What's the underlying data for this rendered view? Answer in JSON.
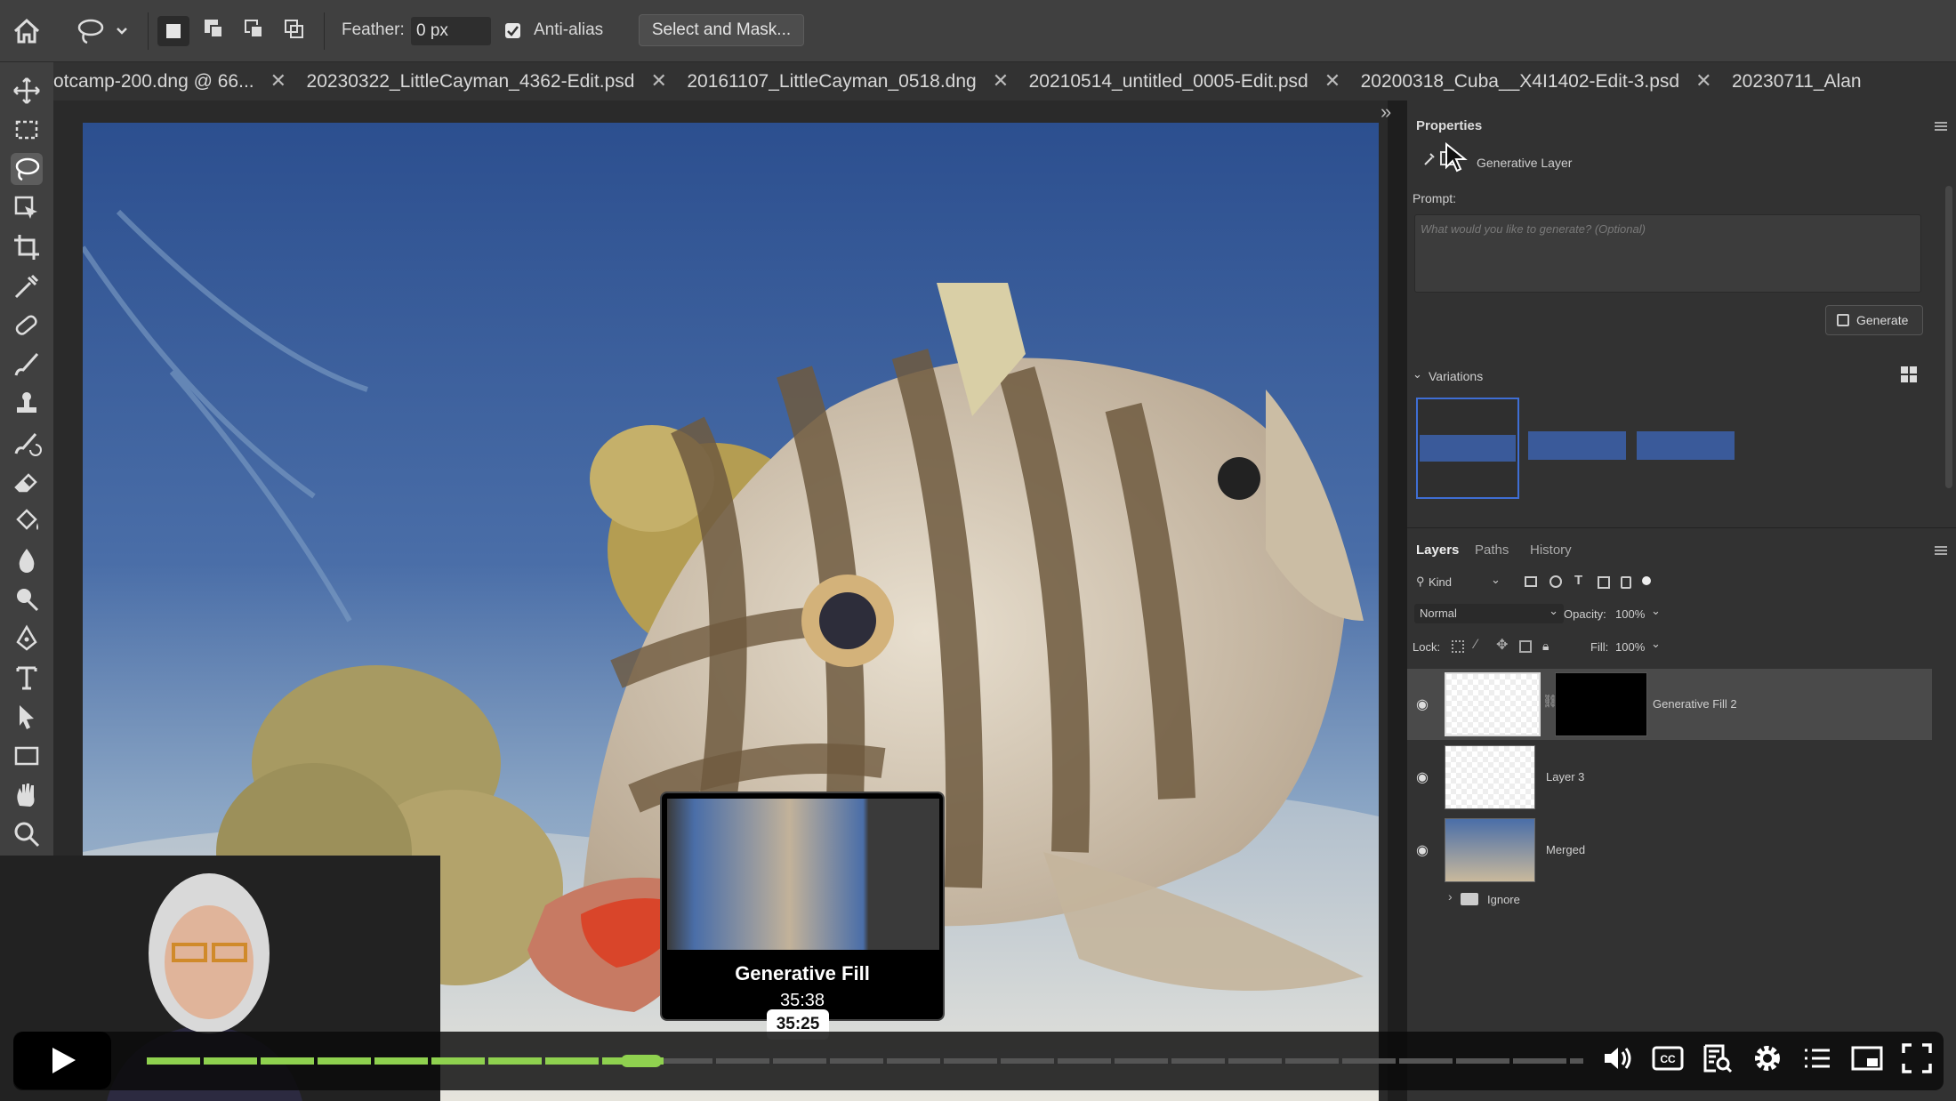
{
  "options_bar": {
    "feather_label": "Feather:",
    "feather_value": "0 px",
    "antialias_label": "Anti-alias",
    "select_mask_label": "Select and Mask..."
  },
  "tabs": [
    {
      "label": "otcamp-200.dng @ 66..."
    },
    {
      "label": "20230322_LittleCayman_4362-Edit.psd"
    },
    {
      "label": "20161107_LittleCayman_0518.dng"
    },
    {
      "label": "20210514_untitled_0005-Edit.psd"
    },
    {
      "label": "20200318_Cuba__X4I1402-Edit-3.psd"
    },
    {
      "label": "20230711_Alan"
    }
  ],
  "properties": {
    "title": "Properties",
    "layer_type": "Generative Layer",
    "prompt_label": "Prompt:",
    "prompt_placeholder": "What would you like to generate? (Optional)",
    "generate_label": "Generate",
    "variations_label": "Variations"
  },
  "layers_panel": {
    "tabs": [
      "Layers",
      "Paths",
      "History"
    ],
    "kind_label": "Kind",
    "blend_mode": "Normal",
    "opacity_label": "Opacity:",
    "opacity_value": "100%",
    "lock_label": "Lock:",
    "fill_label": "Fill:",
    "fill_value": "100%",
    "layers": [
      {
        "name": "Generative Fill 2"
      },
      {
        "name": "Layer 3"
      },
      {
        "name": "Merged"
      },
      {
        "name": "Ignore"
      }
    ]
  },
  "video": {
    "preview_title": "Generative Fill",
    "preview_time": "35:38",
    "current_time": "35:25",
    "progress_fraction": 0.36
  }
}
